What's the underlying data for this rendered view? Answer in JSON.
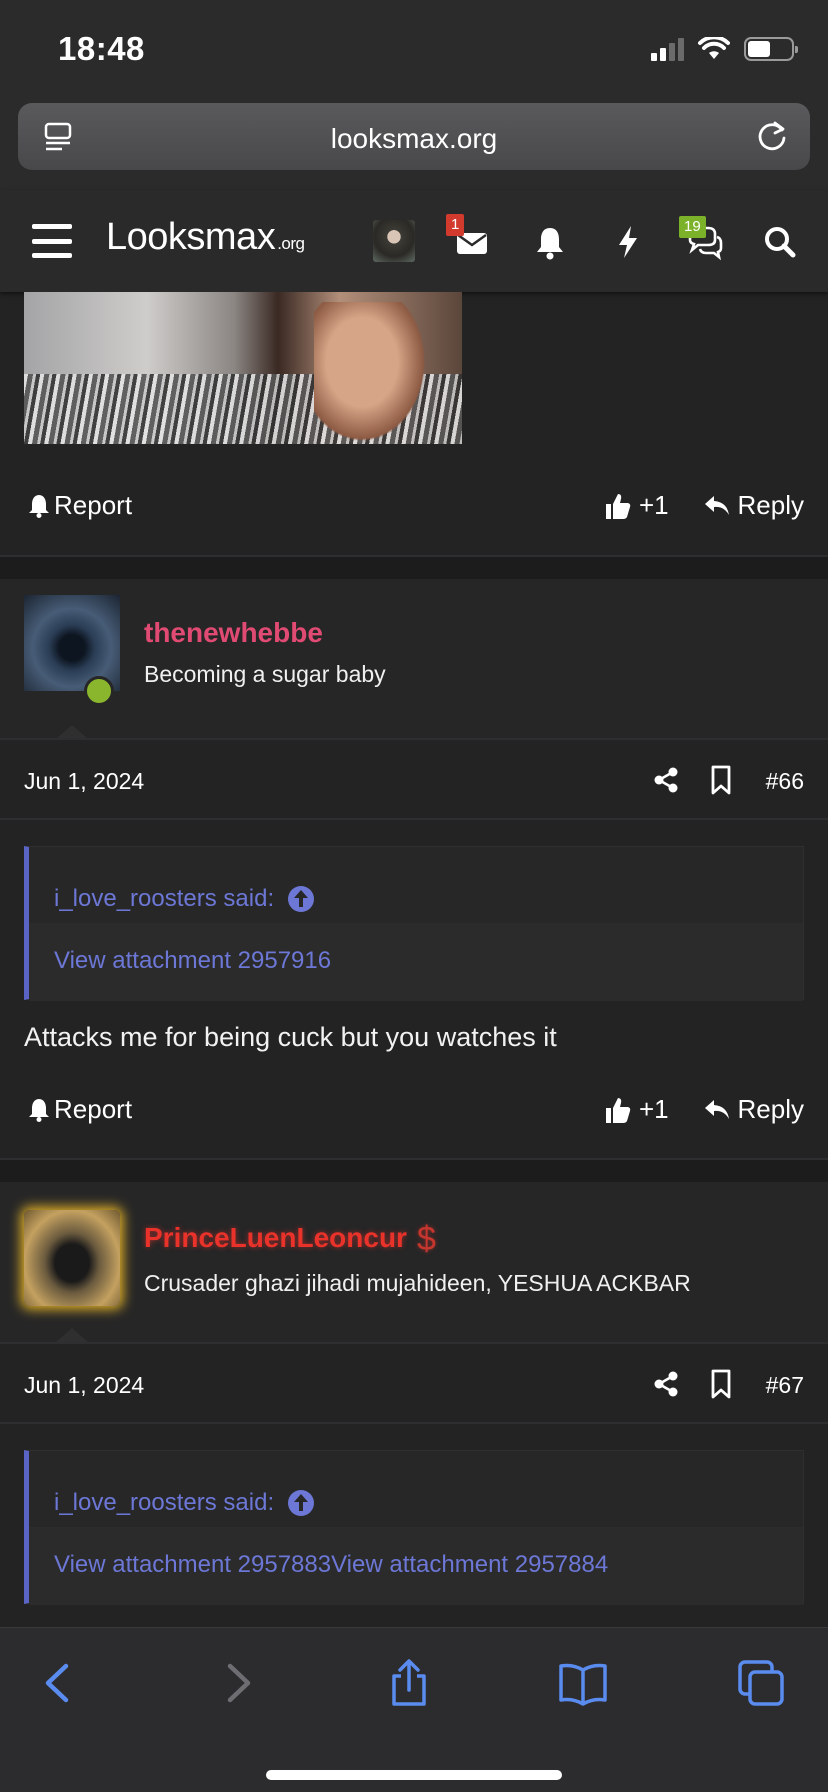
{
  "status": {
    "time": "18:48"
  },
  "browser": {
    "url": "looksmax.org"
  },
  "site": {
    "logo_main": "Looksmax",
    "logo_suffix": ".org",
    "inbox_badge": "1",
    "conversations_badge": "19"
  },
  "posts": [
    {
      "report_label": "Report",
      "like_label": "+1",
      "reply_label": "Reply"
    },
    {
      "username": "thenewhebbe",
      "user_title": "Becoming a sugar baby",
      "date": "Jun 1, 2024",
      "post_number": "#66",
      "quote_author": "i_love_roosters said:",
      "quote_body": "View attachment 2957916",
      "text": "Attacks me for being cuck but you watches it",
      "report_label": "Report",
      "like_label": "+1",
      "reply_label": "Reply"
    },
    {
      "username": "PrinceLuenLeoncur",
      "username_symbol": "$",
      "user_title": "Crusader ghazi jihadi mujahideen, YESHUA ACKBAR",
      "date": "Jun 1, 2024",
      "post_number": "#67",
      "quote_author": "i_love_roosters said:",
      "quote_body": "View attachment 2957883View attachment 2957884"
    }
  ],
  "colors": {
    "accent": "#6c77d6",
    "username_pink": "#e04a73",
    "username_red": "#e8322a",
    "online": "#8ab62d"
  }
}
